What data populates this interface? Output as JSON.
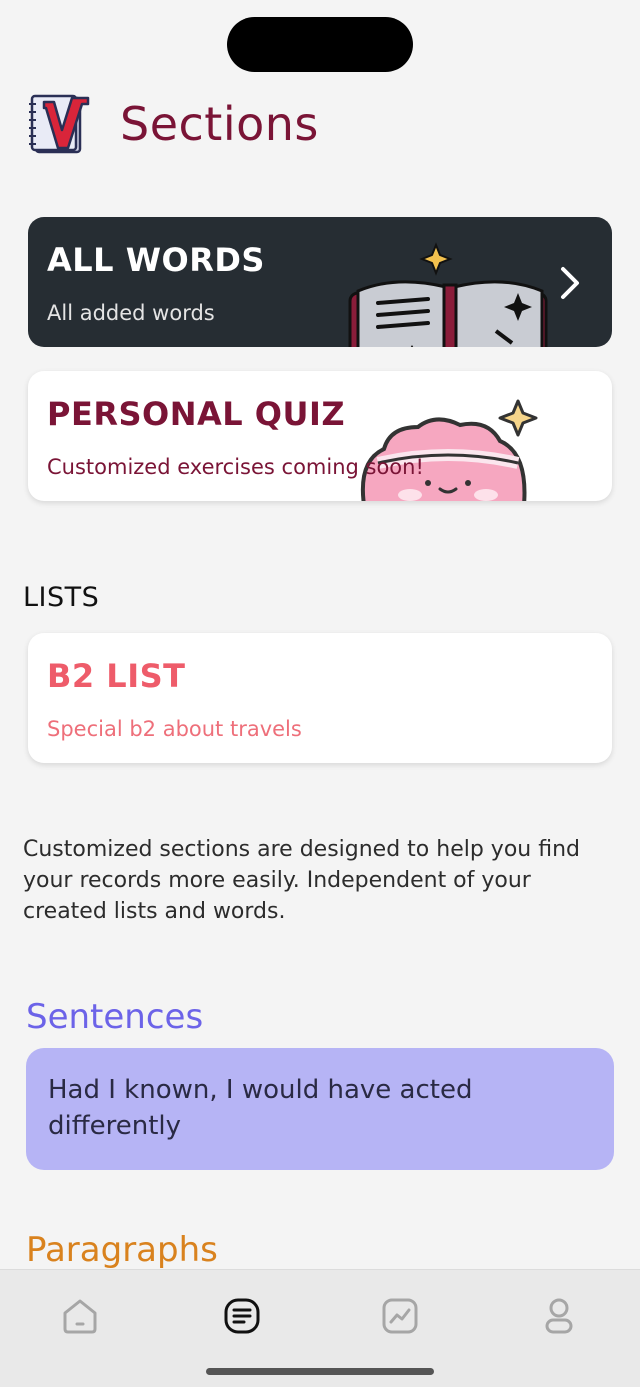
{
  "header": {
    "title": "Sections",
    "logo_icon": "vocabulary-notebook-logo"
  },
  "cards": {
    "all_words": {
      "title": "ALL WORDS",
      "subtitle": "All added words",
      "icon": "open-book-illustration"
    },
    "personal_quiz": {
      "title": "PERSONAL QUIZ",
      "subtitle": "Customized exercises coming soon!",
      "icon": "brain-illustration"
    }
  },
  "lists": {
    "label": "LISTS",
    "items": [
      {
        "title": "B2 LIST",
        "subtitle": "Special b2 about travels"
      }
    ]
  },
  "info": "Customized sections are designed to help you find your records more easily. Independent of your created lists and words.",
  "sentences": {
    "heading": "Sentences",
    "items": [
      "Had I known, I would have acted differently"
    ]
  },
  "paragraphs": {
    "heading": "Paragraphs"
  },
  "tabbar": {
    "tabs": [
      {
        "name": "home",
        "icon": "home-icon"
      },
      {
        "name": "sections",
        "icon": "sections-icon",
        "active": true
      },
      {
        "name": "stats",
        "icon": "stats-icon"
      },
      {
        "name": "profile",
        "icon": "profile-icon"
      }
    ]
  },
  "colors": {
    "title": "#7a1436",
    "dark_card": "#262d33",
    "list_accent": "#ee5c6a",
    "sentences_accent": "#6c63e8",
    "sentence_card": "#b6b4f5",
    "paragraphs_accent": "#d9821e"
  }
}
